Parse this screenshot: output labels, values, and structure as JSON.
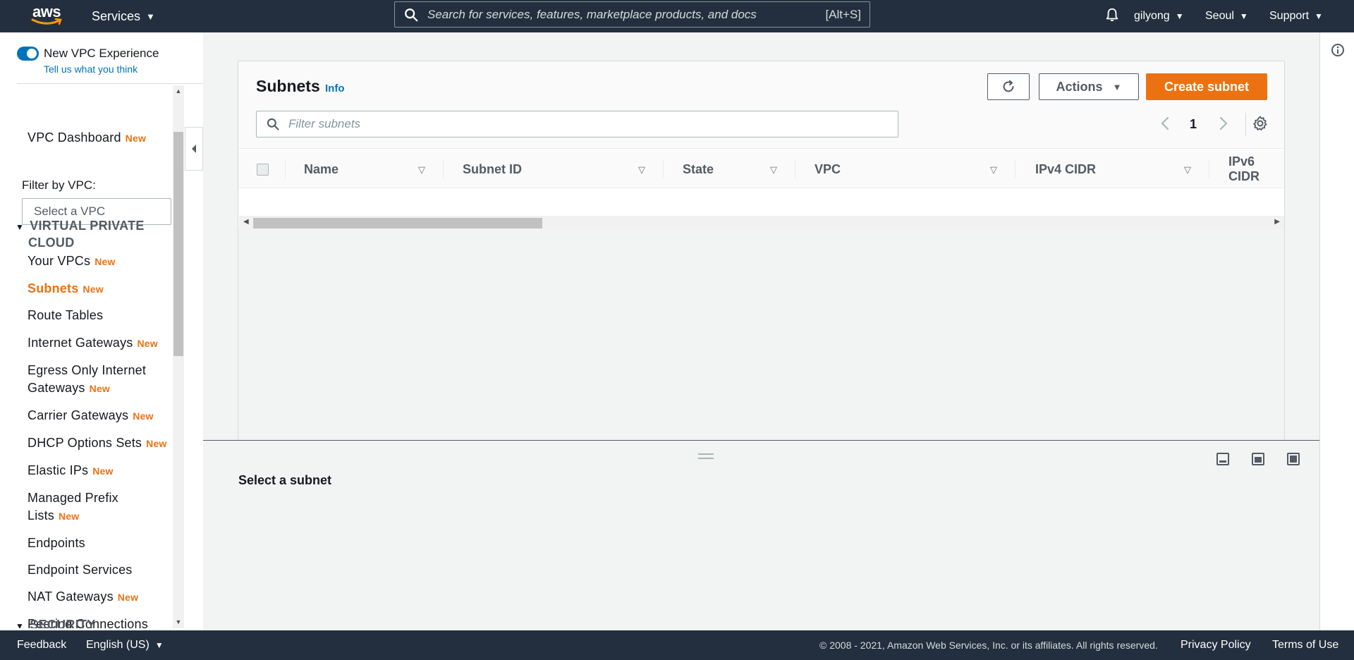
{
  "topbar": {
    "logo_text": "aws",
    "services_label": "Services",
    "search_placeholder": "Search for services, features, marketplace products, and docs",
    "search_shortcut": "[Alt+S]",
    "user_label": "gilyong",
    "region_label": "Seoul",
    "support_label": "Support"
  },
  "sidebar": {
    "toggle_label": "New VPC Experience",
    "feedback_link": "Tell us what you think",
    "dashboard": {
      "label": "VPC Dashboard",
      "badge": "New"
    },
    "filter_label": "Filter by VPC:",
    "filter_placeholder": "Select a VPC",
    "section_vpc": "VIRTUAL PRIVATE CLOUD",
    "section_vpc_line1": "VIRTUAL PRIVATE",
    "section_vpc_line2": "CLOUD",
    "items": [
      {
        "label": "Your VPCs",
        "badge": "New"
      },
      {
        "label": "Subnets",
        "badge": "New"
      },
      {
        "label": "Route Tables",
        "badge": ""
      },
      {
        "label": "Internet Gateways",
        "badge": "New"
      },
      {
        "label": "Egress Only Internet",
        "label2": "Gateways",
        "badge": "New"
      },
      {
        "label": "Carrier Gateways",
        "badge": "New"
      },
      {
        "label": "DHCP Options Sets",
        "badge": "New"
      },
      {
        "label": "Elastic IPs",
        "badge": "New"
      },
      {
        "label": "Managed Prefix",
        "label2": "Lists",
        "badge": "New"
      },
      {
        "label": "Endpoints",
        "badge": ""
      },
      {
        "label": "Endpoint Services",
        "badge": ""
      },
      {
        "label": "NAT Gateways",
        "badge": "New"
      },
      {
        "label": "Peering Connections",
        "badge": ""
      }
    ],
    "section_security": "SECURITY"
  },
  "panel": {
    "title": "Subnets",
    "info_link": "Info",
    "actions_label": "Actions",
    "create_label": "Create subnet",
    "filter_placeholder": "Filter subnets",
    "page_number": "1",
    "columns": [
      "Name",
      "Subnet ID",
      "State",
      "VPC",
      "IPv4 CIDR",
      "IPv6 CIDR"
    ]
  },
  "details": {
    "empty_text": "Select a subnet"
  },
  "footer": {
    "feedback": "Feedback",
    "language": "English (US)",
    "copyright": "© 2008 - 2021, Amazon Web Services, Inc. or its affiliates. All rights reserved.",
    "privacy": "Privacy Policy",
    "terms": "Terms of Use"
  },
  "colors": {
    "nav_bg": "#232f3e",
    "accent_orange": "#ec7211",
    "link_blue": "#0073bb"
  }
}
